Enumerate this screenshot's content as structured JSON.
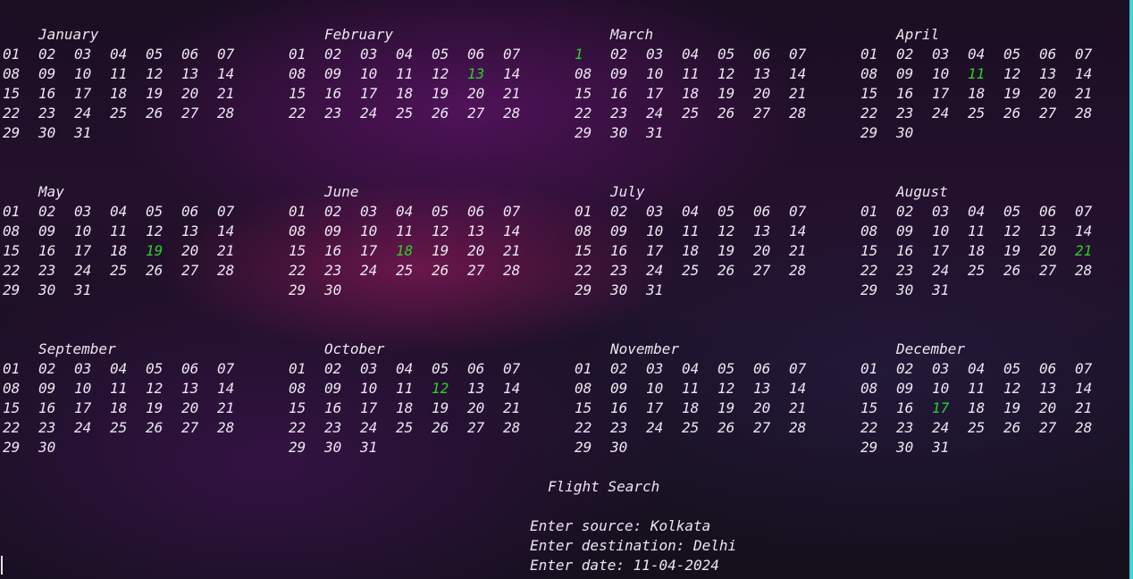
{
  "accent_color": "#2ecc2e",
  "months": [
    {
      "name": "January",
      "days": 31,
      "highlight": null
    },
    {
      "name": "February",
      "days": 28,
      "highlight": "13"
    },
    {
      "name": "March",
      "days": 31,
      "highlight": "1"
    },
    {
      "name": "April",
      "days": 30,
      "highlight": "11"
    },
    {
      "name": "May",
      "days": 31,
      "highlight": "19"
    },
    {
      "name": "June",
      "days": 30,
      "highlight": "18"
    },
    {
      "name": "July",
      "days": 31,
      "highlight": null
    },
    {
      "name": "August",
      "days": 31,
      "highlight": "21"
    },
    {
      "name": "September",
      "days": 30,
      "highlight": null
    },
    {
      "name": "October",
      "days": 31,
      "highlight": "12"
    },
    {
      "name": "November",
      "days": 30,
      "highlight": null
    },
    {
      "name": "December",
      "days": 31,
      "highlight": "17"
    }
  ],
  "footer": {
    "title": "Flight Search",
    "source_line": "Enter source: Kolkata",
    "destination_line": "Enter destination: Delhi",
    "date_line": "Enter date: 11-04-2024"
  }
}
